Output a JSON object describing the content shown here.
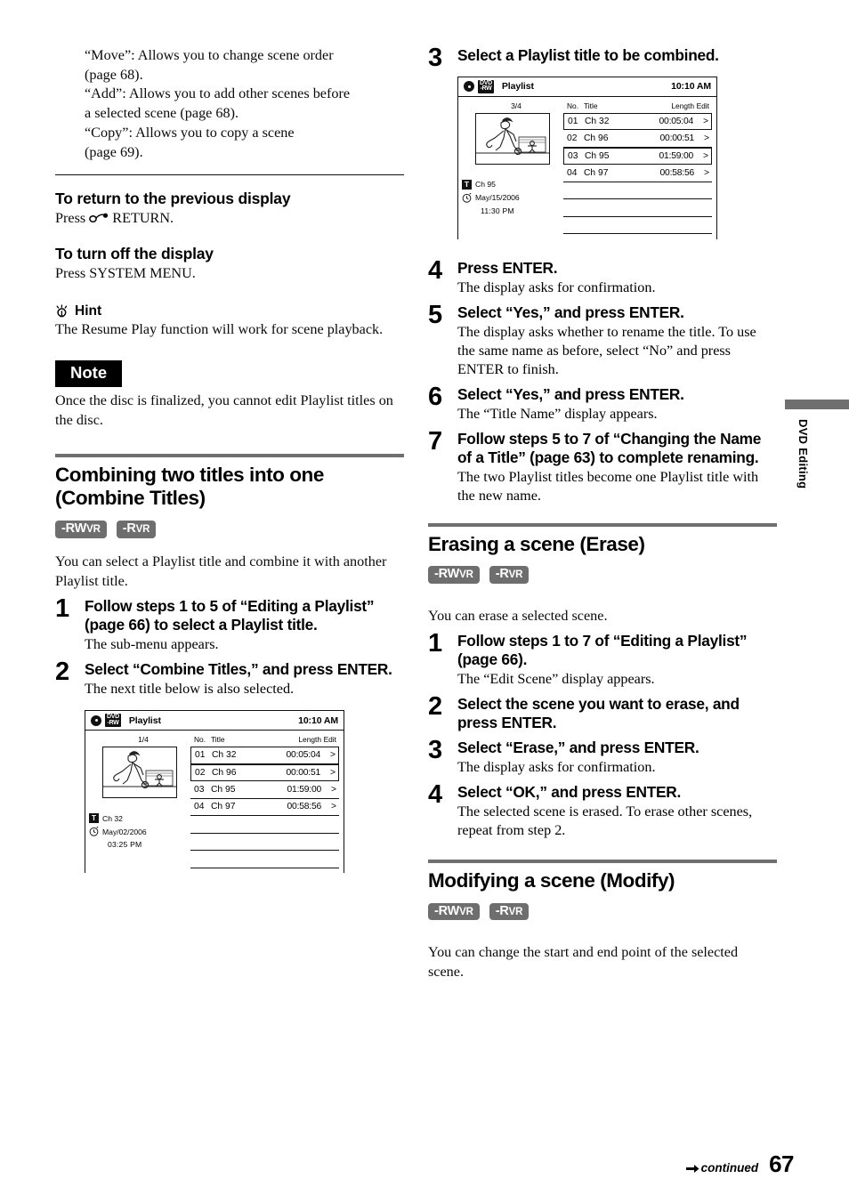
{
  "page_number": "67",
  "footer": {
    "continued_label": "continued"
  },
  "side_tab": {
    "label": "DVD Editing"
  },
  "left_column": {
    "intro_lines": [
      "“Move”: Allows you to change scene order",
      "(page 68).",
      "“Add”: Allows you to add other scenes before",
      "a selected scene (page 68).",
      "“Copy”: Allows you to copy a scene",
      "(page 69)."
    ],
    "return_heading": "To return to the previous display",
    "return_text_before": "Press",
    "return_text_after": "RETURN.",
    "turnoff_heading": "To turn off the display",
    "turnoff_text": "Press SYSTEM MENU.",
    "hint_label": "Hint",
    "hint_text": "The Resume Play function will work for scene playback.",
    "note_label": "Note",
    "note_text": "Once the disc is finalized, you cannot edit Playlist titles on the disc.",
    "section_title_line1": "Combining two titles into one",
    "section_title_line2": "(Combine Titles)",
    "badges": [
      {
        "prefix": "-RW",
        "suffix": "VR"
      },
      {
        "prefix": "-R",
        "suffix": "VR"
      }
    ],
    "section_intro": "You can select a Playlist title and combine it with another Playlist title.",
    "steps": [
      {
        "num": "1",
        "title": "Follow steps 1 to 5 of “Editing a Playlist” (page 66) to select a Playlist title.",
        "note": "The sub-menu appears."
      },
      {
        "num": "2",
        "title": "Select “Combine Titles,” and press ENTER.",
        "note": "The next title below is also selected."
      }
    ]
  },
  "right_column": {
    "steps": [
      {
        "num": "3",
        "title": "Select a Playlist title to be combined.",
        "note": ""
      },
      {
        "num": "4",
        "title": "Press ENTER.",
        "note": "The display asks for confirmation."
      },
      {
        "num": "5",
        "title": "Select “Yes,” and press ENTER.",
        "note": "The display asks whether to rename the title. To use the same name as before, select “No” and press ENTER to finish."
      },
      {
        "num": "6",
        "title": "Select “Yes,” and press ENTER.",
        "note": "The “Title Name” display appears."
      },
      {
        "num": "7",
        "title": "Follow steps 5 to 7 of “Changing the Name of a Title” (page 63) to complete renaming.",
        "note": "The two Playlist titles become one Playlist title with the new name."
      }
    ],
    "erase_section": {
      "title": "Erasing a scene (Erase)",
      "badges": [
        {
          "prefix": "-RW",
          "suffix": "VR"
        },
        {
          "prefix": "-R",
          "suffix": "VR"
        }
      ],
      "intro": "You can erase a selected scene.",
      "steps": [
        {
          "num": "1",
          "title": "Follow steps 1 to 7 of “Editing a Playlist” (page 66).",
          "note": "The “Edit Scene” display appears."
        },
        {
          "num": "2",
          "title": "Select the scene you want to erase, and press ENTER.",
          "note": ""
        },
        {
          "num": "3",
          "title": "Select “Erase,” and press ENTER.",
          "note": "The display asks for confirmation."
        },
        {
          "num": "4",
          "title": "Select “OK,” and press ENTER.",
          "note": "The selected scene is erased. To erase other scenes, repeat from step 2."
        }
      ]
    },
    "modify_section": {
      "title": "Modifying a scene (Modify)",
      "badges": [
        {
          "prefix": "-RW",
          "suffix": "VR"
        },
        {
          "prefix": "-R",
          "suffix": "VR"
        }
      ],
      "intro": "You can change the start and end point of the selected scene."
    }
  },
  "osd_left": {
    "disc_chip_line1": "DVD",
    "disc_chip_line2": "-RW",
    "title": "Playlist",
    "clock": "10:10 AM",
    "page_indicator": "1/4",
    "meta_title": "Ch 32",
    "meta_title_chip": "T",
    "meta_date": "May/02/2006",
    "meta_time": "03:25  PM",
    "columns": {
      "no": "No.",
      "title": "Title",
      "length": "Length",
      "edit": "Edit"
    },
    "rows": [
      {
        "no": "01",
        "title": "Ch 32",
        "length": "00:05:04",
        "edit": ">",
        "selected": true
      },
      {
        "no": "02",
        "title": "Ch 96",
        "length": "00:00:51",
        "edit": ">",
        "selected": true
      },
      {
        "no": "03",
        "title": "Ch 95",
        "length": "01:59:00",
        "edit": ">",
        "selected": false
      },
      {
        "no": "04",
        "title": "Ch 97",
        "length": "00:58:56",
        "edit": ">",
        "selected": false
      }
    ],
    "empty_rows": 3
  },
  "osd_right": {
    "disc_chip_line1": "DVD",
    "disc_chip_line2": "-RW",
    "title": "Playlist",
    "clock": "10:10 AM",
    "page_indicator": "3/4",
    "meta_title": "Ch 95",
    "meta_title_chip": "T",
    "meta_date": "May/15/2006",
    "meta_time": "11:30  PM",
    "columns": {
      "no": "No.",
      "title": "Title",
      "length": "Length",
      "edit": "Edit"
    },
    "rows": [
      {
        "no": "01",
        "title": "Ch 32",
        "length": "00:05:04",
        "edit": ">",
        "selected": true
      },
      {
        "no": "02",
        "title": "Ch 96",
        "length": "00:00:51",
        "edit": ">",
        "selected": false
      },
      {
        "no": "03",
        "title": "Ch 95",
        "length": "01:59:00",
        "edit": ">",
        "selected": true
      },
      {
        "no": "04",
        "title": "Ch 97",
        "length": "00:58:56",
        "edit": ">",
        "selected": false
      }
    ],
    "empty_rows": 3
  },
  "colors": {
    "rule_gray": "#6f6f6f",
    "badge_gray": "#6e6e6e",
    "ink": "#000000"
  }
}
